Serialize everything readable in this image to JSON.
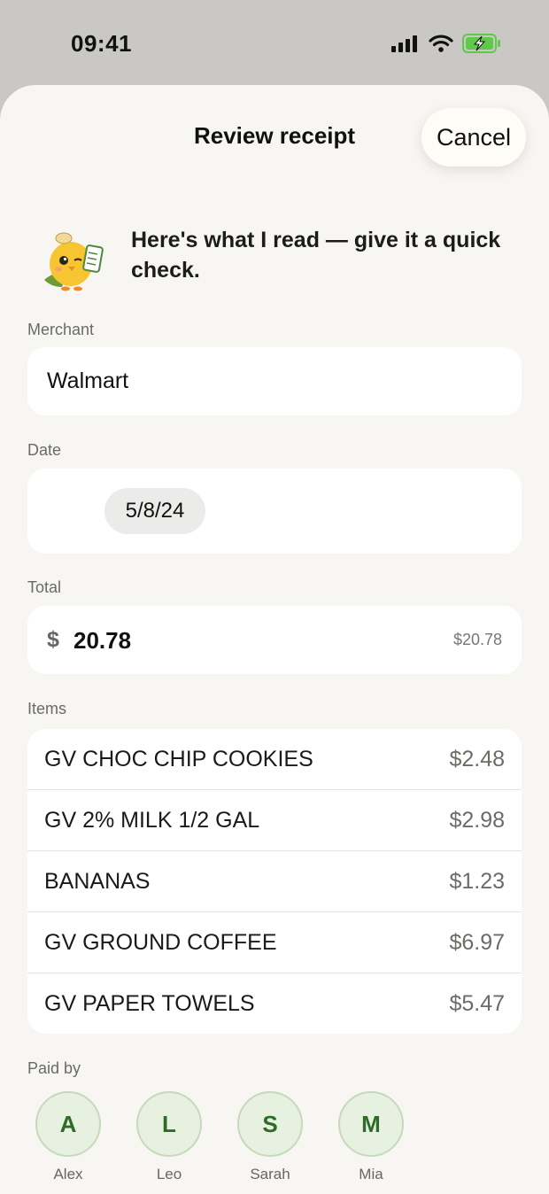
{
  "status_bar": {
    "time": "09:41"
  },
  "sheet": {
    "title": "Review receipt",
    "cancel_label": "Cancel"
  },
  "intro": {
    "text": "Here's what I read — give it a quick check."
  },
  "form": {
    "merchant_label": "Merchant",
    "merchant_value": "Walmart",
    "date_label": "Date",
    "date_value": "5/8/24",
    "total_label": "Total",
    "currency_symbol": "$",
    "total_value": "20.78",
    "total_hint": "$20.78"
  },
  "items": {
    "label": "Items",
    "rows": [
      {
        "name": "GV CHOC CHIP COOKIES",
        "price": "$2.48"
      },
      {
        "name": "GV 2% MILK 1/2 GAL",
        "price": "$2.98"
      },
      {
        "name": "BANANAS",
        "price": "$1.23"
      },
      {
        "name": "GV GROUND COFFEE",
        "price": "$6.97"
      },
      {
        "name": "GV PAPER TOWELS",
        "price": "$5.47"
      }
    ]
  },
  "paid_by": {
    "label": "Paid by",
    "people": [
      {
        "initial": "A",
        "name": "Alex"
      },
      {
        "initial": "L",
        "name": "Leo"
      },
      {
        "initial": "S",
        "name": "Sarah"
      },
      {
        "initial": "M",
        "name": "Mia"
      }
    ]
  },
  "colors": {
    "accent_green": "#2e6b2a",
    "battery_green": "#5fc94a"
  }
}
